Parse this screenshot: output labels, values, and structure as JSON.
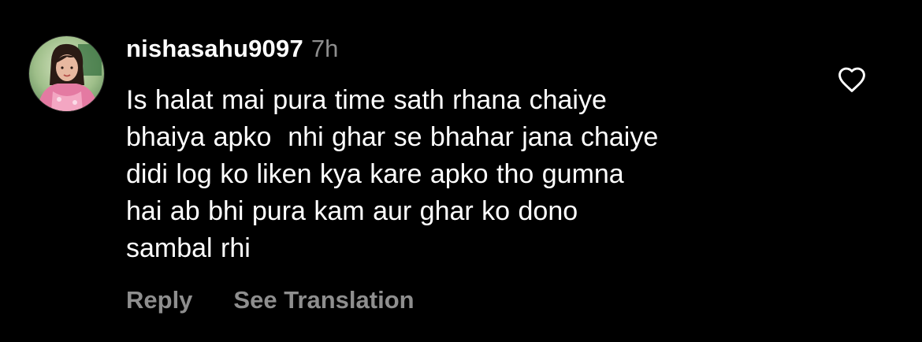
{
  "comment": {
    "username": "nishasahu9097",
    "timestamp": "7h",
    "text": "Is halat mai pura time sath rhana chaiye\nbhaiya apko  nhi ghar se bhahar jana chaiye\ndidi log ko liken kya kare apko tho gumna\nhai ab bhi pura kam aur ghar ko dono\nsambal rhi",
    "avatar_icon": "profile-photo",
    "like_icon": "heart-outline-icon",
    "actions": {
      "reply_label": "Reply",
      "translate_label": "See Translation"
    }
  },
  "colors": {
    "background": "#000000",
    "text": "#ffffff",
    "secondary": "#8e8e8e"
  }
}
